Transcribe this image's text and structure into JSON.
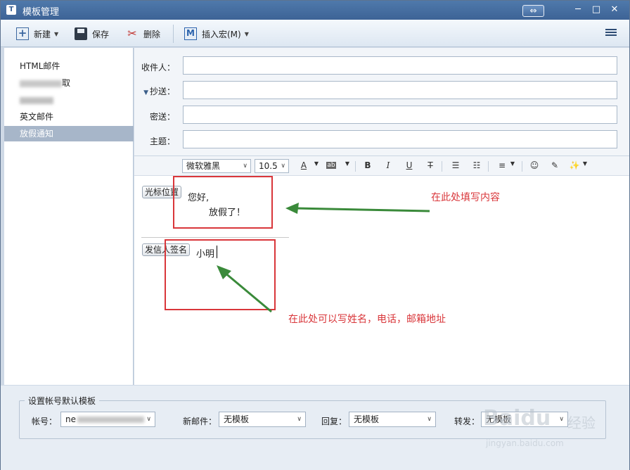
{
  "window": {
    "title": "模板管理",
    "icon": "template-app-icon",
    "swap_glyph": "⇔",
    "min_glyph": "─",
    "max_glyph": "□",
    "close_glyph": "✕"
  },
  "toolbar": {
    "new_label": "新建",
    "save_label": "保存",
    "delete_label": "删除",
    "macro_label": "插入宏(M)",
    "new_icon_glyph": "+",
    "delete_icon_glyph": "✂",
    "macro_icon_glyph": "M",
    "caret": "▼"
  },
  "sidebar": {
    "items": [
      {
        "label": "HTML邮件"
      },
      {
        "label": "取"
      },
      {
        "label": ""
      },
      {
        "label": "英文邮件"
      },
      {
        "label": "放假通知"
      }
    ],
    "selected_index": 4
  },
  "fields": {
    "to_label": "收件人：",
    "cc_label": "抄送：",
    "cc_toggle": "▼",
    "bcc_label": "密送：",
    "subject_label": "主题："
  },
  "format_bar": {
    "font": "微软雅黑",
    "size": "10.5",
    "font_color_glyph": "A",
    "highlight_glyph": "ab",
    "bold": "B",
    "italic": "I",
    "underline": "U",
    "strike": "T",
    "bullets": "☰",
    "numbers": "☷",
    "align": "≡",
    "emoji": "☺",
    "clear": "✎",
    "magic": "✨"
  },
  "editor": {
    "cursor_tag": "光标位置",
    "greeting": "您好,",
    "body": "放假了！",
    "sender_tag": "发信人签名",
    "signature": "小明"
  },
  "annotations": {
    "note1": "在此处填写内容",
    "note2": "在此处可以写姓名，电话，邮箱地址",
    "color": "#d9363a",
    "arrow_color": "#3a8a3a"
  },
  "defaults": {
    "group_title": "设置帐号默认模板",
    "account_label": "帐号：",
    "account_value": "ne",
    "new_mail_label": "新邮件：",
    "new_mail_value": "无模板",
    "reply_label": "回复：",
    "reply_value": "无模板",
    "forward_label": "转发：",
    "forward_value": "无模板"
  },
  "watermark": {
    "brand": "Baidu",
    "brand_cn": "经验",
    "url": "jingyan.baidu.com"
  }
}
